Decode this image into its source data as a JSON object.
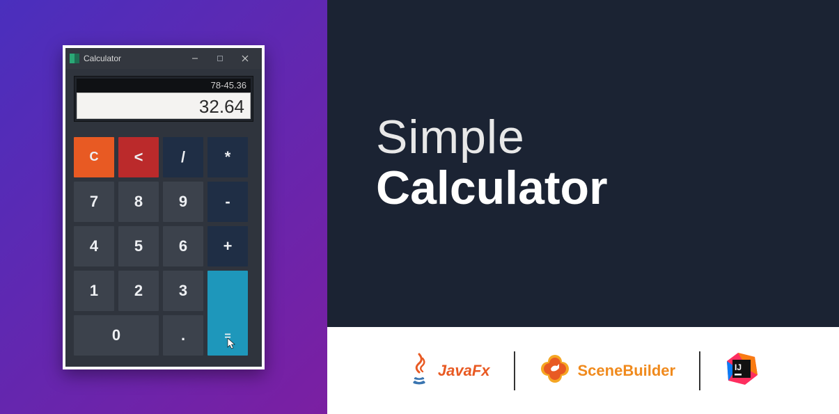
{
  "window": {
    "title": "Calculator"
  },
  "display": {
    "expression": "78-45.36",
    "result": "32.64"
  },
  "keys": {
    "clear": "C",
    "back": "<",
    "divide": "/",
    "multiply": "*",
    "seven": "7",
    "eight": "8",
    "nine": "9",
    "minus": "-",
    "four": "4",
    "five": "5",
    "six": "6",
    "plus": "+",
    "one": "1",
    "two": "2",
    "three": "3",
    "equals": "=",
    "zero": "0",
    "decimal": "."
  },
  "hero": {
    "line1": "Simple",
    "line2": "Calculator"
  },
  "tech": {
    "javafx": "JavaFx",
    "scenebuilder": "SceneBuilder",
    "intellij_glyph": "IJ"
  },
  "colors": {
    "accent_orange": "#e85a23",
    "accent_red": "#bb2a2b",
    "accent_cyan": "#1e97bb",
    "key_default": "#3c424c",
    "key_operator": "#1f2e45"
  }
}
